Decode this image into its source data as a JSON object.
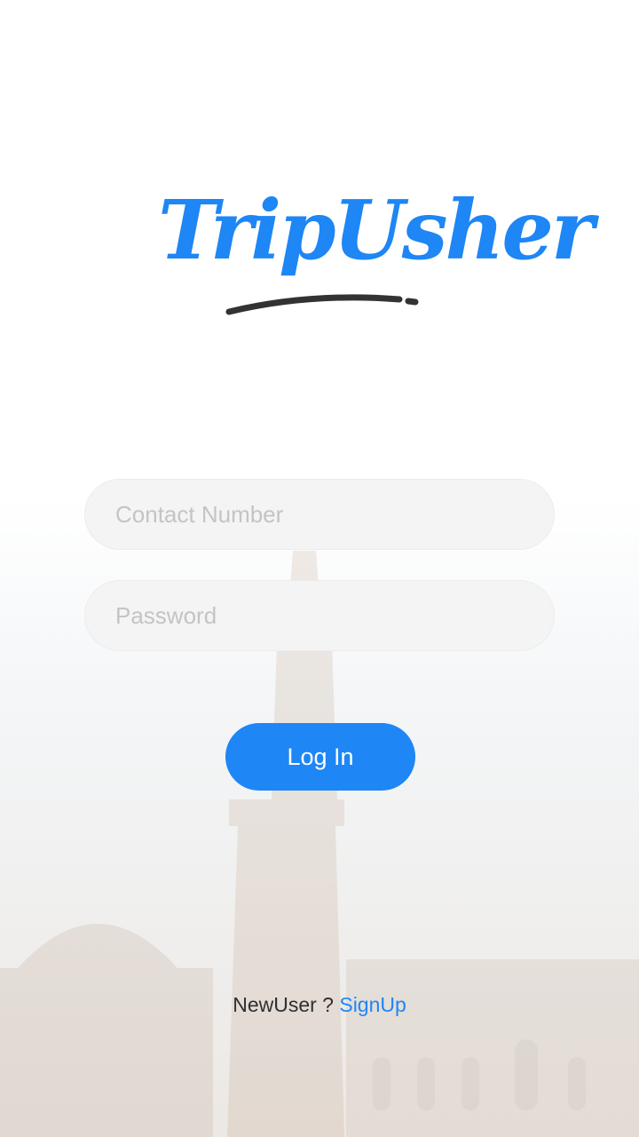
{
  "app": {
    "logo_text": "TripUsher"
  },
  "login_form": {
    "contact_placeholder": "Contact Number",
    "password_placeholder": "Password",
    "login_label": "Log In"
  },
  "signup": {
    "prompt": "NewUser ?",
    "link_label": "SignUp"
  },
  "colors": {
    "brand_blue": "#1e86f5",
    "field_bg": "#f4f4f4",
    "placeholder": "#c4c4c4",
    "swoosh": "#333333"
  }
}
